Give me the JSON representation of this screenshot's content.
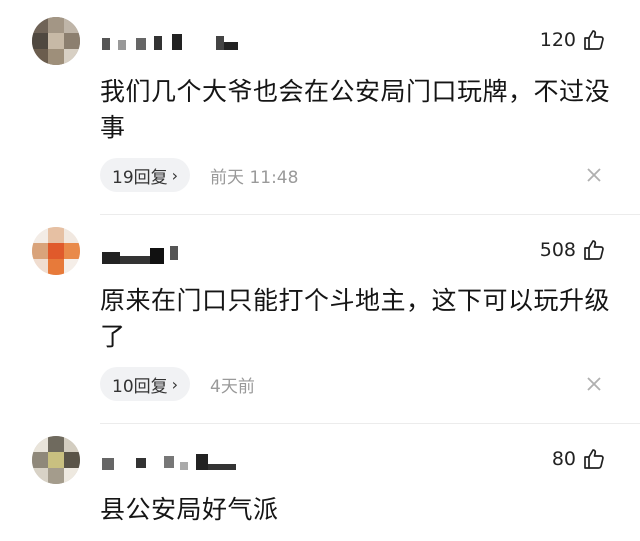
{
  "comments": [
    {
      "likes": "120",
      "text": "我们几个大爷也会在公安局门口玩牌，不过没事",
      "reply_label": "19回复",
      "time": "前天 11:48"
    },
    {
      "likes": "508",
      "text": "原来在门口只能打个斗地主，这下可以玩升级了",
      "reply_label": "10回复",
      "time": "4天前"
    },
    {
      "likes": "80",
      "text": "县公安局好气派"
    }
  ],
  "colors": {
    "background": "#ffffff",
    "reply_pill": "#f1f2f4",
    "muted_text": "#9a9a9a"
  },
  "icons": [
    "thumbs-up-icon",
    "close-icon",
    "chevron-right-icon"
  ]
}
